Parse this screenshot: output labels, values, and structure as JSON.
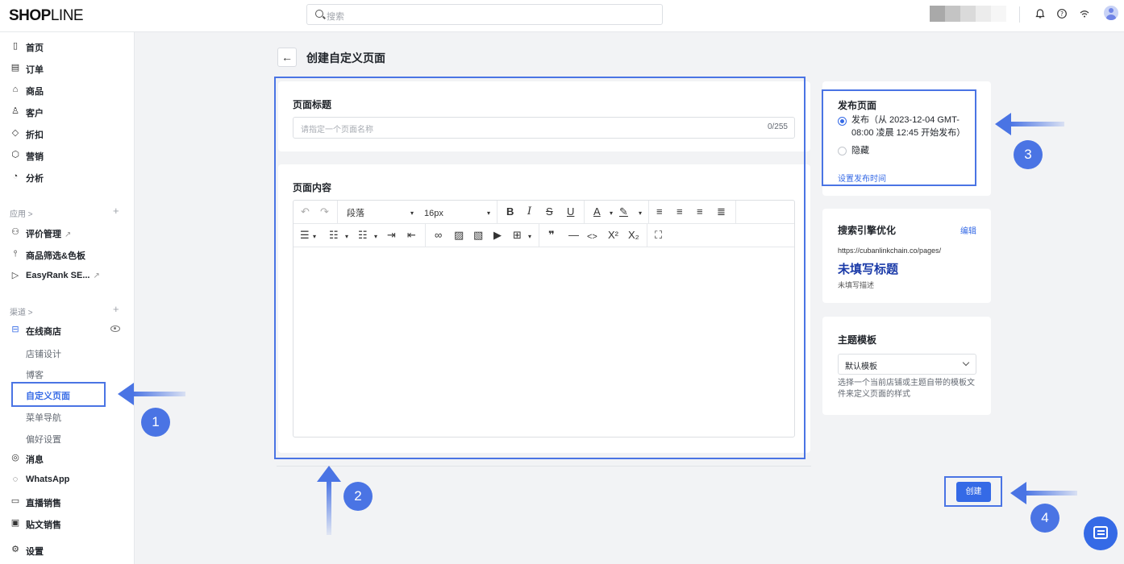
{
  "header": {
    "logo_main": "SHOP",
    "logo_light": "LINE",
    "search_placeholder": "搜索"
  },
  "sidebar": {
    "main_items": [
      {
        "label": "首页",
        "icon": "home-icon"
      },
      {
        "label": "订单",
        "icon": "order-icon"
      },
      {
        "label": "商品",
        "icon": "product-icon"
      },
      {
        "label": "客户",
        "icon": "customer-icon"
      },
      {
        "label": "折扣",
        "icon": "discount-icon"
      },
      {
        "label": "营销",
        "icon": "marketing-icon"
      },
      {
        "label": "分析",
        "icon": "analytics-icon"
      }
    ],
    "apps_section": "应用 >",
    "apps": [
      {
        "label": "评价管理",
        "external": "↗"
      },
      {
        "label": "商品筛选&色板",
        "external": ""
      },
      {
        "label": "EasyRank SE...",
        "external": "↗"
      }
    ],
    "channels_section": "渠道 >",
    "online_store": "在线商店",
    "store_subitems": [
      "店铺设计",
      "博客",
      "自定义页面",
      "菜单导航",
      "偏好设置"
    ],
    "bottom_items": [
      {
        "label": "消息",
        "icon": "message-icon"
      },
      {
        "label": "WhatsApp",
        "icon": "whatsapp-icon"
      },
      {
        "label": "直播销售",
        "icon": "live-icon"
      },
      {
        "label": "贴文销售",
        "icon": "post-icon"
      },
      {
        "label": "设置",
        "icon": "settings-icon"
      }
    ]
  },
  "page": {
    "title": "创建自定义页面",
    "title_label": "页面标题",
    "title_placeholder": "请指定一个页面名称",
    "title_counter": "0/255",
    "content_label": "页面内容",
    "paragraph_select": "段落",
    "font_size_select": "16px"
  },
  "publish": {
    "heading": "发布页面",
    "option_publish": "发布（从 2023-12-04 GMT-08:00 凌晨 12:45 开始发布）",
    "option_hide": "隐藏",
    "set_time_link": "设置发布时间"
  },
  "seo": {
    "heading": "搜索引擎优化",
    "edit_link": "编辑",
    "url": "https://cubanlinkchain.co/pages/",
    "title_placeholder": "未填写标题",
    "desc_placeholder": "未填写描述"
  },
  "theme": {
    "heading": "主题模板",
    "selected": "默认模板",
    "help": "选择一个当前店铺或主题自带的模板文件来定义页面的样式"
  },
  "actions": {
    "create_label": "创建"
  },
  "annotations": {
    "step1": "1",
    "step2": "2",
    "step3": "3",
    "step4": "4",
    "highlight_color": "#4a74e4"
  }
}
